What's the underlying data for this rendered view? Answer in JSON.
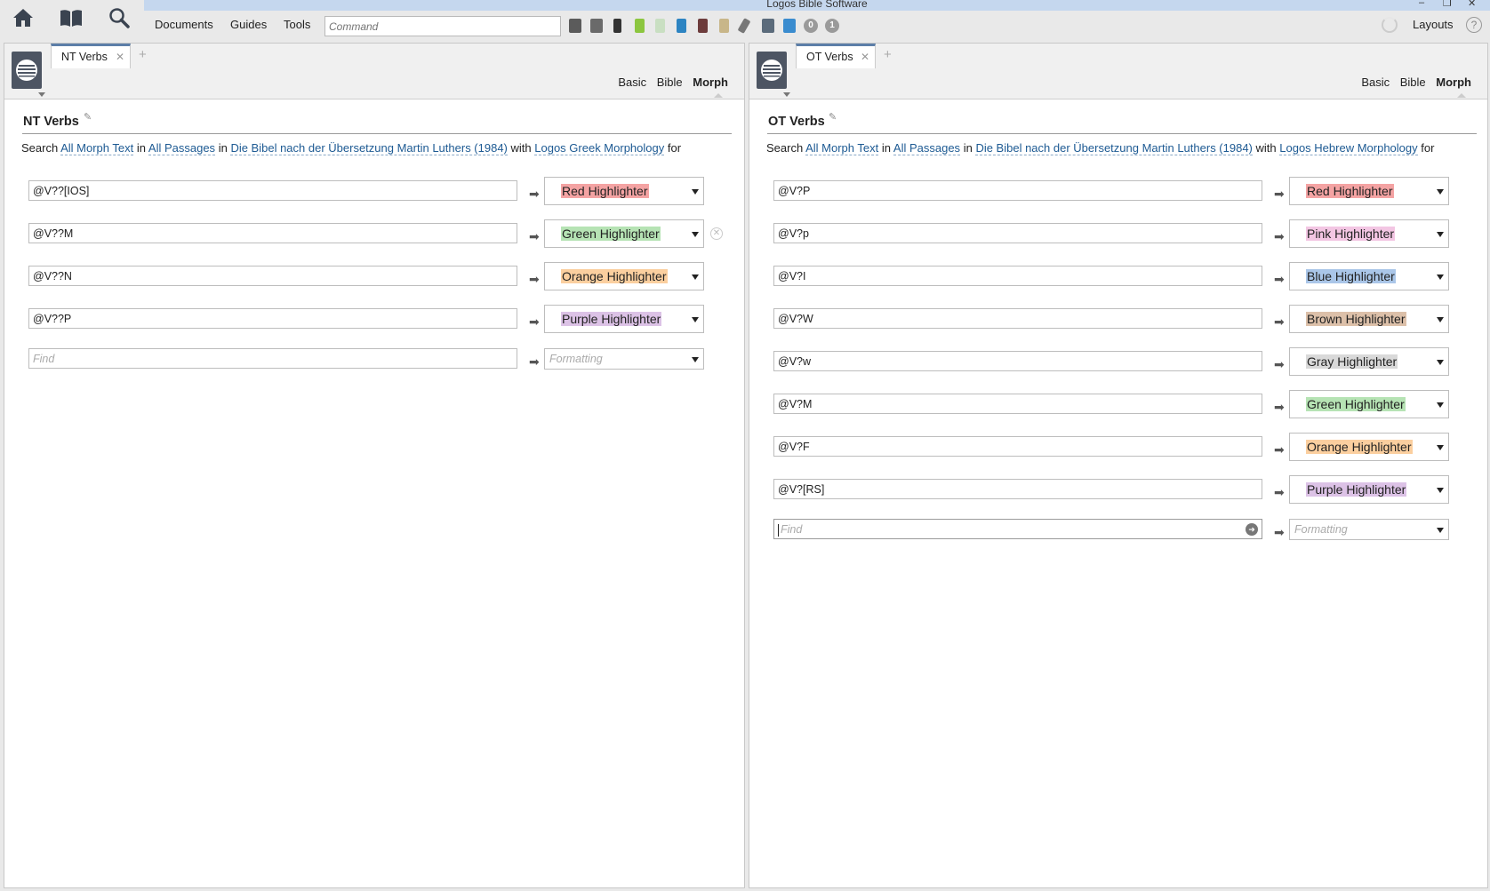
{
  "window": {
    "title": "Logos Bible Software"
  },
  "toolbar": {
    "menus": [
      "Documents",
      "Guides",
      "Tools"
    ],
    "command_placeholder": "Command",
    "badges": [
      "0",
      "1"
    ],
    "layouts_label": "Layouts",
    "help_label": "?"
  },
  "panels": [
    {
      "tab_label": "NT Verbs",
      "modes": [
        "Basic",
        "Bible",
        "Morph"
      ],
      "active_mode": "Morph",
      "doc_title": "NT Verbs",
      "sentence": {
        "w1": "Search",
        "l1": "All Morph Text",
        "w2": "in",
        "l2": "All Passages",
        "w3": "in",
        "l3": "Die Bibel nach der Übersetzung Martin Luthers (1984)",
        "w4": "with",
        "l4": "Logos Greek Morphology",
        "w5": "for"
      },
      "rows": [
        {
          "find": "@V??[IOS]",
          "format": "Red Highlighter",
          "color": "#f4a3a3"
        },
        {
          "find": "@V??M",
          "format": "Green Highlighter",
          "color": "#b6e3b4"
        },
        {
          "find": "@V??N",
          "format": "Orange Highlighter",
          "color": "#fbcf9f"
        },
        {
          "find": "@V??P",
          "format": "Purple Highlighter",
          "color": "#dcc2e6"
        }
      ],
      "new_row": {
        "find_placeholder": "Find",
        "format_placeholder": "Formatting"
      }
    },
    {
      "tab_label": "OT Verbs",
      "modes": [
        "Basic",
        "Bible",
        "Morph"
      ],
      "active_mode": "Morph",
      "doc_title": "OT Verbs",
      "sentence": {
        "w1": "Search",
        "l1": "All Morph Text",
        "w2": "in",
        "l2": "All Passages",
        "w3": "in",
        "l3": "Die Bibel nach der Übersetzung Martin Luthers (1984)",
        "w4": "with",
        "l4": "Logos Hebrew Morphology",
        "w5": "for"
      },
      "rows": [
        {
          "find": "@V?P",
          "format": "Red Highlighter",
          "color": "#f4a3a3"
        },
        {
          "find": "@V?p",
          "format": "Pink Highlighter",
          "color": "#f3c6e3"
        },
        {
          "find": "@V?I",
          "format": "Blue Highlighter",
          "color": "#aac6e8"
        },
        {
          "find": "@V?W",
          "format": "Brown Highlighter",
          "color": "#dcc0a9"
        },
        {
          "find": "@V?w",
          "format": "Gray Highlighter",
          "color": "#d9d9d9"
        },
        {
          "find": "@V?M",
          "format": "Green Highlighter",
          "color": "#b6e3b4"
        },
        {
          "find": "@V?F",
          "format": "Orange Highlighter",
          "color": "#fbcf9f"
        },
        {
          "find": "@V?[RS]",
          "format": "Purple Highlighter",
          "color": "#dcc2e6"
        }
      ],
      "new_row": {
        "find_placeholder": "Find",
        "format_placeholder": "Formatting"
      }
    }
  ]
}
